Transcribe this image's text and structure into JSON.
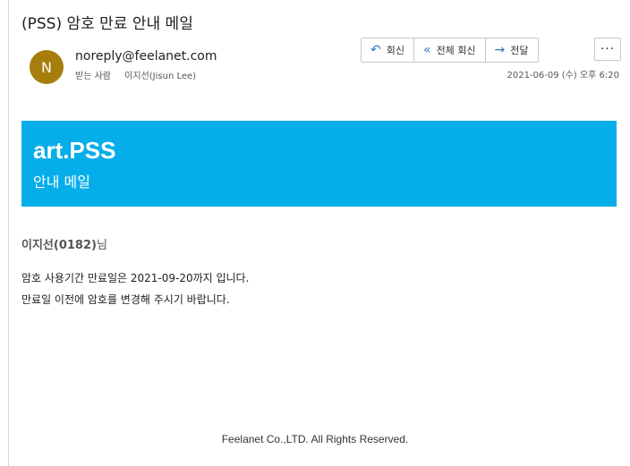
{
  "email": {
    "subject": "(PSS) 암호 만료 안내 메일",
    "avatar_initial": "N",
    "avatar_color": "#a77e0d",
    "sender": "noreply@feelanet.com",
    "to_label": "받는 사람",
    "to_name": "이지선(Jisun Lee)",
    "datetime": "2021-06-09 (수) 오후 6:20"
  },
  "toolbar": {
    "reply_label": "회신",
    "reply_all_label": "전체 회신",
    "forward_label": "전달",
    "more_label": "···"
  },
  "body": {
    "banner_color": "#06aee9",
    "brand": "art.PSS",
    "brand_sub": "안내 메일",
    "greeting_name": "이지선(0182)",
    "greeting_suffix": "님",
    "line1": "암호 사용기간 만료일은 2021-09-20까지 입니다.",
    "line2": "만료일 이전에 암호를 변경해 주시기 바랍니다.",
    "footer": "Feelanet Co.,LTD. All Rights Reserved."
  }
}
